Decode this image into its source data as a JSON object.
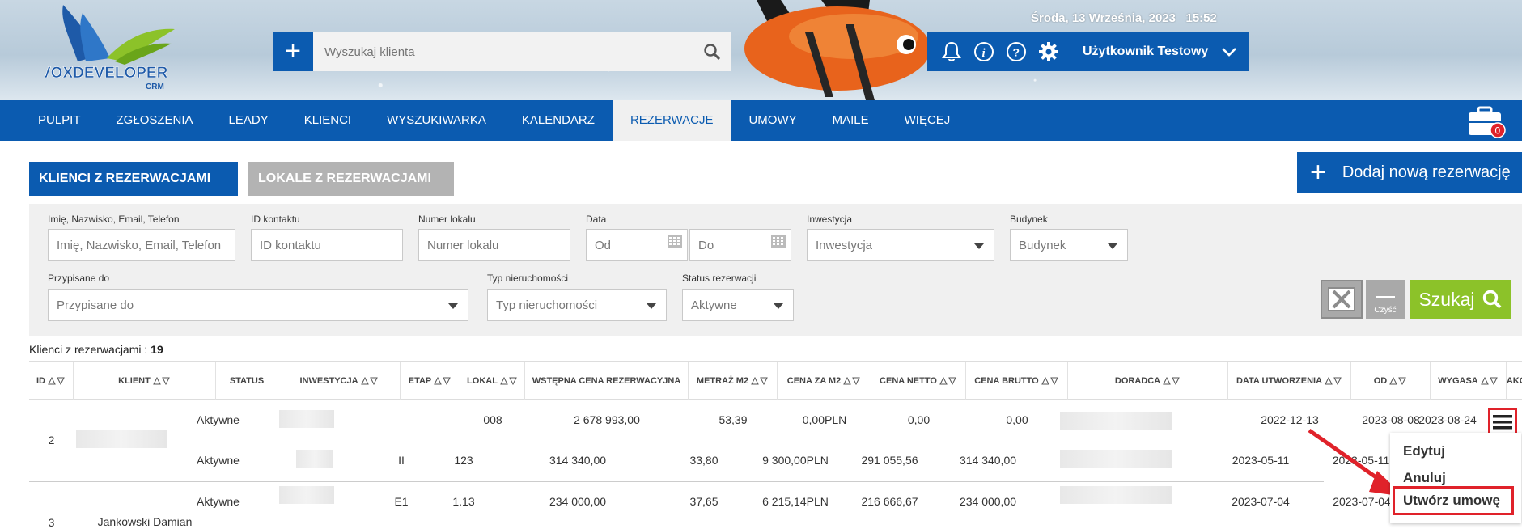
{
  "header": {
    "logo_text": "VOXDEVELOPER",
    "logo_sub": "CRM",
    "datetime": "Środa, 13 Września, 2023   15:52",
    "search_placeholder": "Wyszukaj klienta",
    "user_name": "Użytkownik Testowy"
  },
  "nav": {
    "items": [
      "PULPIT",
      "ZGŁOSZENIA",
      "LEADY",
      "KLIENCI",
      "WYSZUKIWARKA",
      "KALENDARZ",
      "REZERWACJE",
      "UMOWY",
      "MAILE",
      "WIĘCEJ"
    ],
    "active": "REZERWACJE",
    "briefcase_badge": "0"
  },
  "tabs": {
    "primary": "KLIENCI Z REZERWACJAMI",
    "secondary": "LOKALE Z REZERWACJAMI",
    "add_button": "Dodaj nową rezerwację"
  },
  "filters": {
    "name": {
      "label": "Imię, Nazwisko, Email, Telefon",
      "placeholder": "Imię, Nazwisko, Email, Telefon"
    },
    "contact_id": {
      "label": "ID kontaktu",
      "placeholder": "ID kontaktu"
    },
    "unit_number": {
      "label": "Numer lokalu",
      "placeholder": "Numer lokalu"
    },
    "date": {
      "label": "Data",
      "from_placeholder": "Od",
      "to_placeholder": "Do"
    },
    "investment": {
      "label": "Inwestycja",
      "placeholder": "Inwestycja"
    },
    "building": {
      "label": "Budynek",
      "placeholder": "Budynek"
    },
    "assigned": {
      "label": "Przypisane do",
      "placeholder": "Przypisane do"
    },
    "property_type": {
      "label": "Typ nieruchomości",
      "placeholder": "Typ nieruchomości"
    },
    "status": {
      "label": "Status rezerwacji",
      "value": "Aktywne"
    },
    "clear_label": "Czyść",
    "search_label": "Szukaj"
  },
  "count": {
    "label": "Klienci z rezerwacjami : ",
    "value": "19"
  },
  "table": {
    "columns": [
      "ID",
      "KLIENT",
      "STATUS",
      "INWESTYCJA",
      "ETAP",
      "LOKAL",
      "WSTĘPNA CENA REZERWACYJNA",
      "METRAŻ M2",
      "CENA ZA M2",
      "CENA NETTO",
      "CENA BRUTTO",
      "DORADCA",
      "DATA UTWORZENIA",
      "OD",
      "WYGASA",
      "AKCJE"
    ],
    "rows": [
      {
        "id": "2",
        "status": "Aktywne",
        "etap": "",
        "lokal": "008",
        "cena_rez": "2 678 993,00",
        "metraz": "53,39",
        "cena_m2": "0,00PLN",
        "netto": "0,00",
        "brutto": "0,00",
        "data": "2022-12-13",
        "od": "2023-08-08",
        "wygasa": "2023-08-24"
      },
      {
        "id": "",
        "status": "Aktywne",
        "etap": "II",
        "lokal": "123",
        "cena_rez": "314 340,00",
        "metraz": "33,80",
        "cena_m2": "9 300,00PLN",
        "netto": "291 055,56",
        "brutto": "314 340,00",
        "data": "2023-05-11",
        "od": "2023-05-11",
        "wygasa": ""
      },
      {
        "id": "3",
        "klient": "Jankowski Damian",
        "status": "Aktywne",
        "etap": "E1",
        "lokal": "1.13",
        "cena_rez": "234 000,00",
        "metraz": "37,65",
        "cena_m2": "6 215,14PLN",
        "netto": "216 666,67",
        "brutto": "234 000,00",
        "data": "2023-07-04",
        "od": "2023-07-04",
        "wygasa": ""
      }
    ]
  },
  "context_menu": {
    "items": [
      "Edytuj",
      "Anuluj",
      "Utwórz umowę"
    ]
  },
  "colors": {
    "primary": "#0b5bb0",
    "green": "#8cc229",
    "highlight": "#e0222a"
  }
}
